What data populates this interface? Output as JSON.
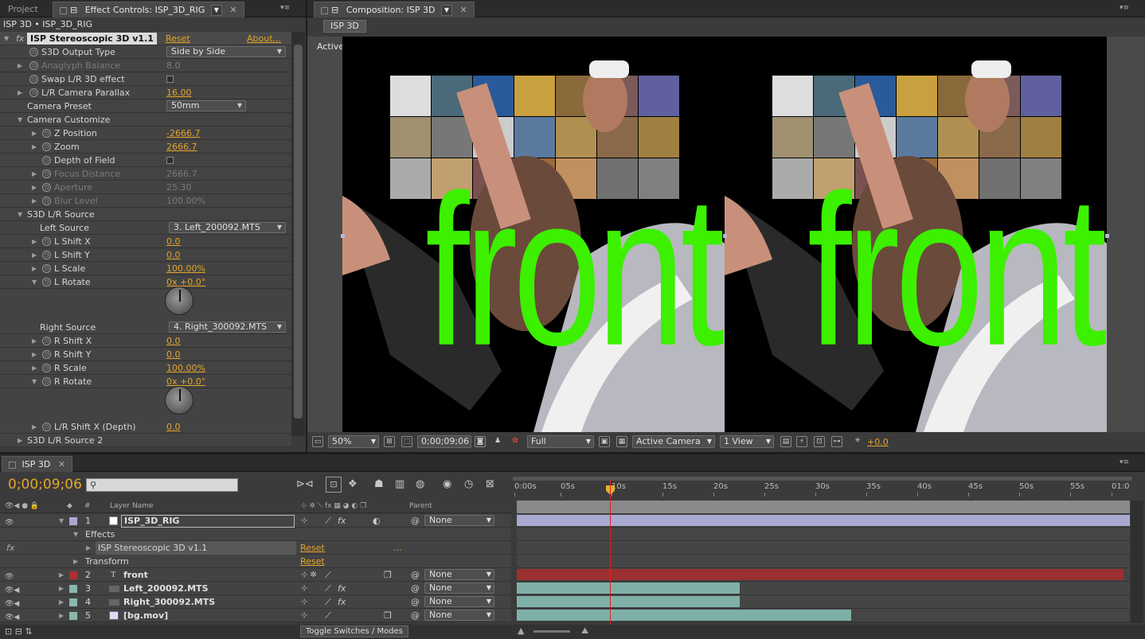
{
  "tabs": {
    "project": "Project",
    "effect_controls": "Effect Controls: ISP_3D_RIG",
    "composition": "Composition: ISP 3D",
    "timeline": "ISP 3D"
  },
  "effect_controls": {
    "header": "ISP 3D • ISP_3D_RIG",
    "effect_name": "ISP Stereoscopic 3D v1.1",
    "reset": "Reset",
    "about": "About...",
    "rows": [
      {
        "label": "S3D Output Type",
        "dropdown": "Side by Side"
      },
      {
        "label": "Anaglyph Balance",
        "value": "8.0"
      },
      {
        "label": "Swap L/R 3D effect"
      },
      {
        "label": "L/R Camera Parallax",
        "value": "16.00"
      },
      {
        "label": "Camera Preset",
        "dropdown": "50mm"
      },
      {
        "label": "Camera Customize"
      },
      {
        "label": "Z Position",
        "value": "-2666.7"
      },
      {
        "label": "Zoom",
        "value": "2666.7"
      },
      {
        "label": "Depth of Field"
      },
      {
        "label": "Focus Distance",
        "value": "2666.7"
      },
      {
        "label": "Aperture",
        "value": "25.30"
      },
      {
        "label": "Blur Level",
        "value": "100.00%"
      },
      {
        "label": "S3D L/R Source"
      },
      {
        "label": "Left Source",
        "dropdown": "3. Left_200092.MTS"
      },
      {
        "label": "L Shift X",
        "value": "0.0"
      },
      {
        "label": "L Shift Y",
        "value": "0.0"
      },
      {
        "label": "L Scale",
        "value": "100.00%"
      },
      {
        "label": "L Rotate",
        "value": "0x +0.0°"
      },
      {
        "label": "Right Source",
        "dropdown": "4. Right_300092.MTS"
      },
      {
        "label": "R Shift X",
        "value": "0.0"
      },
      {
        "label": "R Shift Y",
        "value": "0.0"
      },
      {
        "label": "R Scale",
        "value": "100.00%"
      },
      {
        "label": "R Rotate",
        "value": "0x +0.0°"
      },
      {
        "label": "L/R Shift X (Depth)",
        "value": "0.0"
      },
      {
        "label": "S3D L/R Source 2"
      }
    ]
  },
  "composition": {
    "crumb": "ISP 3D",
    "active_camera_label": "Active Camera",
    "overlay_text": "front",
    "controls": {
      "zoom": "50%",
      "timecode": "0;00;09;06",
      "resolution": "Full",
      "camera": "Active Camera",
      "views": "1 View",
      "exposure": "+0.0"
    }
  },
  "timeline": {
    "current_time": "0;00;09;06",
    "search_placeholder": "",
    "col_layer_name": "Layer Name",
    "col_num": "#",
    "col_parent": "Parent",
    "ruler": [
      "0:00s",
      "05s",
      "10s",
      "15s",
      "20s",
      "25s",
      "30s",
      "35s",
      "40s",
      "45s",
      "50s",
      "55s",
      "01:0"
    ],
    "layers": [
      {
        "num": "1",
        "name": "ISP_3D_RIG",
        "parent": "None",
        "color": "#a9a9d0"
      },
      {
        "name": "Effects"
      },
      {
        "name": "ISP Stereoscopic 3D v1.1",
        "reset": "Reset",
        "more": "..."
      },
      {
        "name": "Transform",
        "reset": "Reset"
      },
      {
        "num": "2",
        "name": "front",
        "parent": "None",
        "color": "#b03030"
      },
      {
        "num": "3",
        "name": "Left_200092.MTS",
        "parent": "None",
        "color": "#8ab8b0"
      },
      {
        "num": "4",
        "name": "Right_300092.MTS",
        "parent": "None",
        "color": "#8ab8b0"
      },
      {
        "num": "5",
        "name": "[bg.mov]",
        "parent": "None",
        "color": "#8ab8b0"
      }
    ],
    "toggle_label": "Toggle Switches / Modes"
  },
  "colors": {
    "accent_value": "#e5a52b",
    "front_text": "#3cf000",
    "cti": "#e02020"
  }
}
